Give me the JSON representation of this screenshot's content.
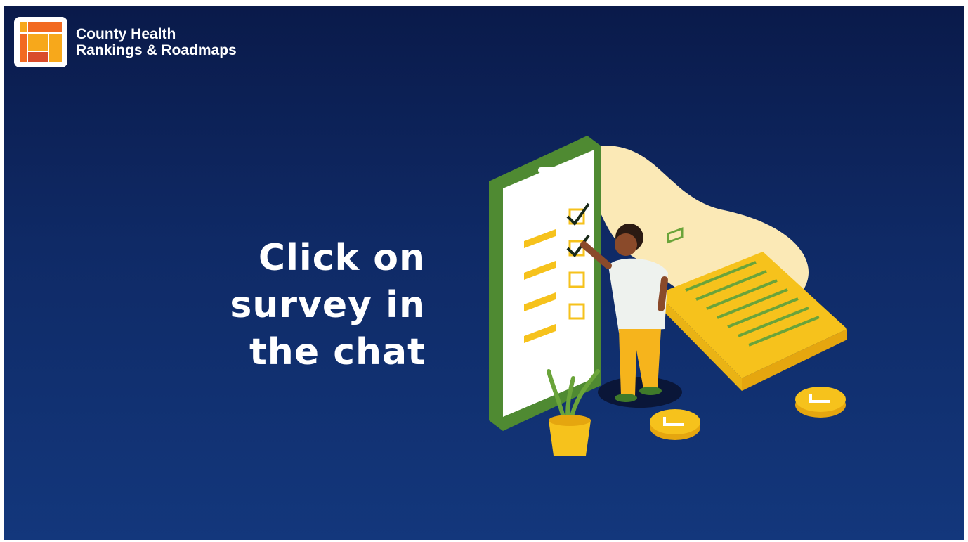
{
  "brand": {
    "name_line1": "County Health",
    "name_line2": "Rankings & Roadmaps",
    "colors": {
      "orange": "#f26a21",
      "gold": "#f7a81b",
      "red": "#d94c2b"
    }
  },
  "headline": {
    "line1": "Click on",
    "line2": "survey in",
    "line3": "the chat"
  },
  "illustration": {
    "description_icon": "survey-checklist-illustration",
    "colors": {
      "phone": "#5b9a3a",
      "accent": "#f6c21c",
      "blob": "#fbe9b6"
    }
  }
}
